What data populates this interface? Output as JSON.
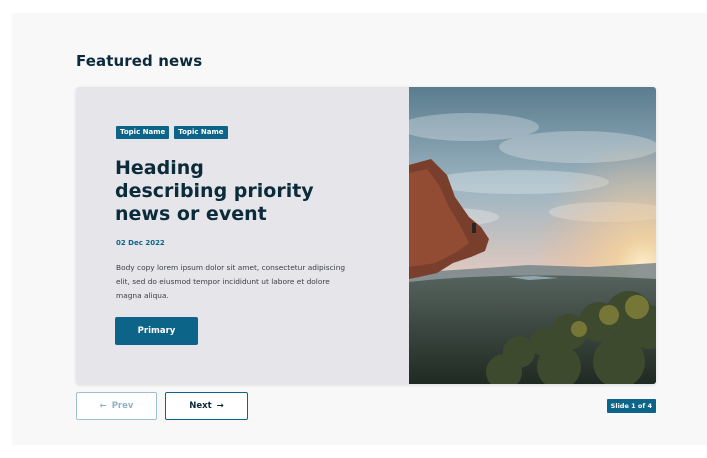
{
  "section": {
    "title": "Featured news"
  },
  "slide": {
    "tags": [
      "Topic Name",
      "Topic Name"
    ],
    "heading_lines": [
      "Heading",
      "describing priority",
      "news or event"
    ],
    "date": "02 Dec 2022",
    "body_lines": [
      "Body copy lorem ipsum dolor sit amet, consectetur adipiscing",
      "elit, sed do eiusmod tempor incididunt ut labore et dolore",
      "magna aliqua."
    ],
    "primary_label": "Primary",
    "image_icon": "landscape-photo"
  },
  "nav": {
    "prev_label": "Prev",
    "prev_icon": "arrow-left-icon",
    "next_label": "Next",
    "next_icon": "arrow-right-icon",
    "indicator": "Slide 1 of 4"
  },
  "colors": {
    "brand": "#0d6489",
    "heading": "#0b2a3a",
    "card_bg": "#e6e5ea",
    "page_bg": "#f8f8f8"
  }
}
